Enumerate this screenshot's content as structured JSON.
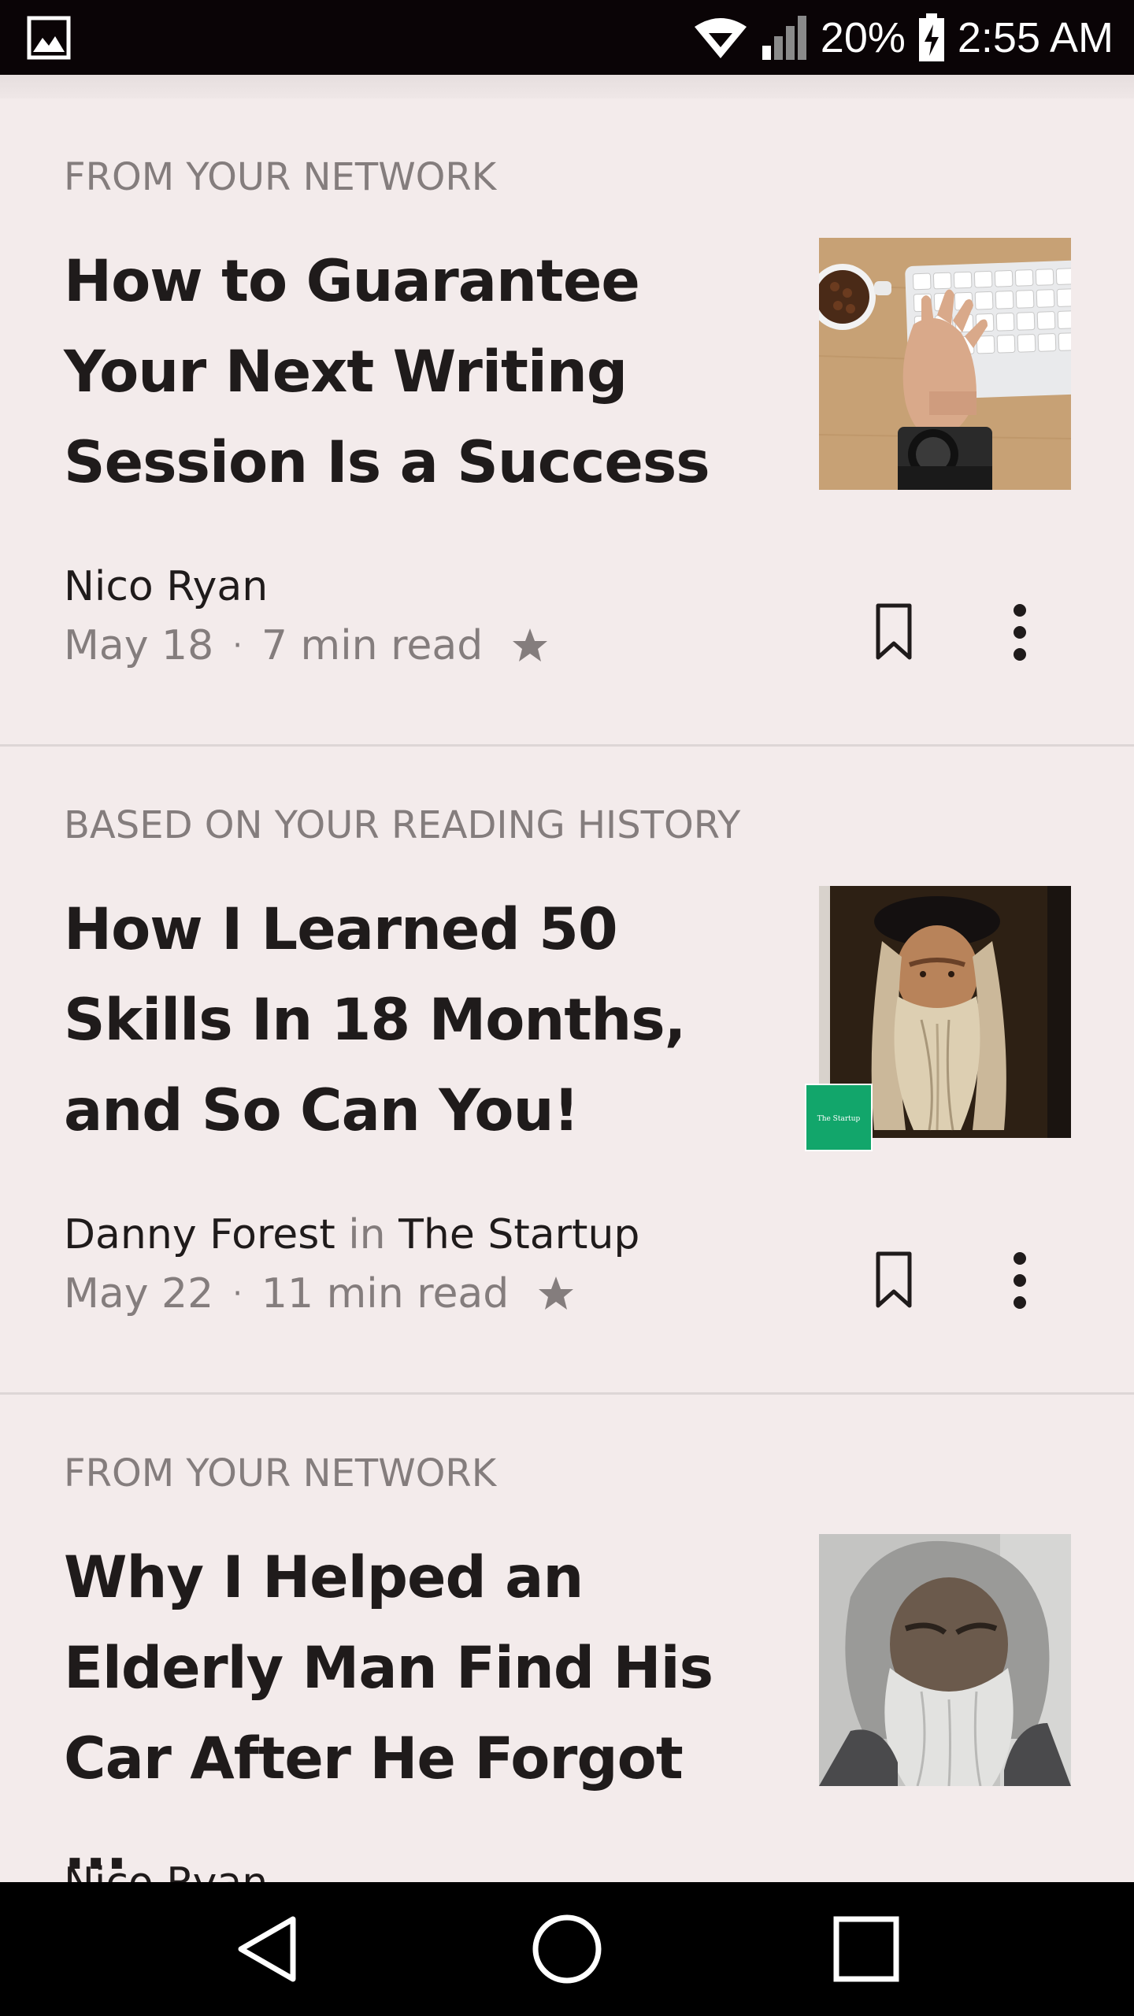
{
  "status_bar": {
    "battery_percent": "20%",
    "time": "2:55 AM",
    "left_icon": "gallery-notification-icon",
    "icons": [
      "wifi-icon",
      "cell-signal-icon",
      "battery-charging-icon"
    ]
  },
  "feed": {
    "cards": [
      {
        "label": "FROM YOUR NETWORK",
        "title": "How to Guarantee Your Next Writing Session Is a Success",
        "author": "Nico Ryan",
        "in_word": "",
        "publication": "",
        "date": "May 18",
        "separator": "·",
        "read_time": "7 min read",
        "thumbnail": "keyboard-and-coffee-photo"
      },
      {
        "label": "BASED ON YOUR READING HISTORY",
        "title": "How I Learned 50 Skills In 18 Months, and So Can You!",
        "author": "Danny Forest",
        "in_word": "in",
        "publication": "The Startup",
        "date": "May 22",
        "separator": "·",
        "read_time": "11 min read",
        "thumbnail": "leonardo-portrait-photo",
        "badge_text": "The Startup"
      },
      {
        "label": "FROM YOUR NETWORK",
        "title": "Why I Helped an Elderly Man Find His Car After He Forgot ...",
        "author": "Nico Ryan",
        "in_word": "",
        "publication": "",
        "date": "",
        "separator": "",
        "read_time": "",
        "thumbnail": "elderly-man-photo"
      }
    ]
  },
  "colors": {
    "background": "#f3ebeb",
    "text_primary": "#1f1b1b",
    "text_secondary": "#847d7d",
    "startup_green": "#12a66b",
    "status_bar": "#0a0406"
  },
  "nav_bar": {
    "buttons": [
      "back-icon",
      "home-icon",
      "recents-icon"
    ]
  }
}
